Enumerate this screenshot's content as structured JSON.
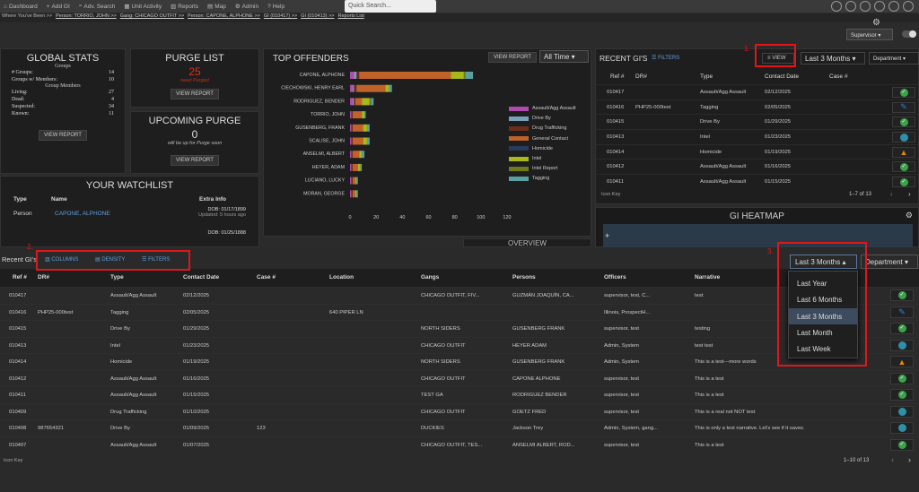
{
  "topbar": {
    "items": [
      "Dashboard",
      "Add GI",
      "Adv. Search",
      "Unit Activity",
      "Reports",
      "Map",
      "Admin",
      "Help"
    ],
    "search_placeholder": "Quick Search...",
    "role": "Supervisor"
  },
  "breadcrumb": {
    "label": "Where You've Been >>",
    "items": [
      "Person: TORRIO, JOHN >>",
      "Gang: CHICAGO OUTFIT >>",
      "Person: CAPONE, ALPHONE >>",
      "GI (010417) >>",
      "GI (010413) >>",
      "Reports List"
    ]
  },
  "global_stats": {
    "title": "GLOBAL STATS",
    "groups_head": "Groups",
    "members_head": "Group Members",
    "rows1": [
      [
        "# Groups:",
        "14"
      ],
      [
        "Groups w/ Members:",
        "10"
      ]
    ],
    "rows2": [
      [
        "Living:",
        "27"
      ],
      [
        "Dead:",
        "4"
      ],
      [
        "Suspected:",
        "34"
      ],
      [
        "Known:",
        "11"
      ]
    ],
    "view": "VIEW REPORT"
  },
  "purge": {
    "title": "PURGE LIST",
    "count": "25",
    "sub": "need Purged",
    "view": "VIEW REPORT"
  },
  "upcoming": {
    "title": "UPCOMING PURGE",
    "count": "0",
    "sub": "will be up for Purge soon",
    "view": "VIEW REPORT"
  },
  "watchlist": {
    "title": "YOUR WATCHLIST",
    "headers": [
      "Type",
      "Name",
      "Extra Info"
    ],
    "rows": [
      {
        "type": "Person",
        "name": "CAPONE, ALPHONE",
        "info1": "DOB: 01/17/1899",
        "info2": "Updated: 5 hours ago"
      },
      {
        "type": "",
        "name": "",
        "info1": "DOB: 01/25/1888",
        "info2": ""
      }
    ]
  },
  "offenders": {
    "title": "TOP OFFENDERS",
    "view": "VIEW REPORT",
    "period": "All Time",
    "names": [
      "CAPONE, ALPHONE",
      "CIECHOWSKI, HENRY EARL",
      "RODRIGUEZ, BENDER",
      "TORRIO, JOHN",
      "GUSENBERG, FRANK",
      "SCALISE, JOHN",
      "ANSELMI, ALBERT",
      "HEYER, ADAM",
      "LUCIANO, LUCKY",
      "MORAN, GEORGE"
    ],
    "ticks": [
      "0",
      "20",
      "40",
      "60",
      "80",
      "100",
      "120"
    ],
    "legend": [
      "Assault/Agg Assault",
      "Drive By",
      "Drug Trafficking",
      "General Contact",
      "Homicide",
      "Intel",
      "Intel Report",
      "Tagging"
    ]
  },
  "chart_data": {
    "type": "bar",
    "orientation": "horizontal",
    "stacked": true,
    "xlim": [
      0,
      120
    ],
    "categories": [
      "CAPONE, ALPHONE",
      "CIECHOWSKI, HENRY EARL",
      "RODRIGUEZ, BENDER",
      "TORRIO, JOHN",
      "GUSENBERG, FRANK",
      "SCALISE, JOHN",
      "ANSELMI, ALBERT",
      "HEYER, ADAM",
      "LUCIANO, LUCKY",
      "MORAN, GEORGE"
    ],
    "series": [
      {
        "name": "Assault/Agg Assault",
        "color": "#b04ab0",
        "values": [
          3,
          2,
          2,
          1,
          1,
          1,
          1,
          1,
          1,
          1
        ]
      },
      {
        "name": "Drive By",
        "color": "#7aa0b8",
        "values": [
          2,
          1,
          1,
          0,
          0,
          0,
          0,
          0,
          0,
          0
        ]
      },
      {
        "name": "Drug Trafficking",
        "color": "#6a2e1e",
        "values": [
          2,
          2,
          1,
          1,
          1,
          1,
          1,
          1,
          1,
          1
        ]
      },
      {
        "name": "General Contact",
        "color": "#c0622a",
        "values": [
          70,
          22,
          5,
          7,
          8,
          8,
          5,
          4,
          2,
          2
        ]
      },
      {
        "name": "Homicide",
        "color": "#2a3a5a",
        "values": [
          0,
          0,
          0,
          0,
          0,
          0,
          0,
          0,
          0,
          0
        ]
      },
      {
        "name": "Intel",
        "color": "#a8b81a",
        "values": [
          10,
          3,
          6,
          2,
          3,
          3,
          2,
          2,
          1,
          1
        ]
      },
      {
        "name": "Intel Report",
        "color": "#6f7a1a",
        "values": [
          1,
          0,
          1,
          0,
          0,
          0,
          0,
          0,
          0,
          0
        ]
      },
      {
        "name": "Tagging",
        "color": "#5aa0a0",
        "values": [
          6,
          2,
          2,
          1,
          2,
          2,
          2,
          1,
          1,
          1
        ]
      }
    ],
    "legend_position": "right"
  },
  "recent_small": {
    "title": "RECENT GI'S",
    "filters": "FILTERS",
    "view": "VIEW",
    "period": "Last 3 Months",
    "dept": "Department",
    "headers": [
      "Ref #",
      "DR#",
      "Type",
      "Contact Date",
      "Case #"
    ],
    "rows": [
      {
        "ref": "010417",
        "dr": "",
        "type": "Assault/Agg Assault",
        "date": "02/12/2025",
        "icon": "check"
      },
      {
        "ref": "010416",
        "dr": "PHP25-000test",
        "type": "Tagging",
        "date": "02/05/2025",
        "icon": "pencil"
      },
      {
        "ref": "010415",
        "dr": "",
        "type": "Drive By",
        "date": "01/29/2025",
        "icon": "check"
      },
      {
        "ref": "010413",
        "dr": "",
        "type": "Intel",
        "date": "01/23/2025",
        "icon": "globe"
      },
      {
        "ref": "010414",
        "dr": "",
        "type": "Homicide",
        "date": "01/19/2025",
        "icon": "warn"
      },
      {
        "ref": "010412",
        "dr": "",
        "type": "Assault/Agg Assault",
        "date": "01/16/2025",
        "icon": "check"
      },
      {
        "ref": "010411",
        "dr": "",
        "type": "Assault/Agg Assault",
        "date": "01/15/2025",
        "icon": "check"
      }
    ],
    "iconkey": "Icon Key",
    "pager": "1–7 of 13"
  },
  "heatmap": {
    "title": "GI HEATMAP"
  },
  "overview": {
    "title": "OVERVIEW"
  },
  "annotations": {
    "one": "1.",
    "two": "2.",
    "three": "3."
  },
  "main": {
    "title": "Recent GI's",
    "columns": "COLUMNS",
    "density": "DENSITY",
    "filters": "FILTERS",
    "period": "Last 3 Months",
    "dept": "Department",
    "headers": [
      "Ref #",
      "DR#",
      "Type",
      "Contact Date",
      "Case #",
      "Location",
      "Gangs",
      "Persons",
      "Officers",
      "Narrative"
    ],
    "rows": [
      {
        "ref": "010417",
        "dr": "",
        "type": "Assault/Agg Assault",
        "date": "02/12/2025",
        "case": "",
        "loc": "",
        "gangs": "CHICAGO OUTFIT, FIV...",
        "persons": "GUZMÁN JOAQUÍN, CA...",
        "officers": "supervisor, test, C...",
        "narr": "test",
        "icon": "check"
      },
      {
        "ref": "010416",
        "dr": "PHP25-000test",
        "type": "Tagging",
        "date": "02/05/2025",
        "case": "",
        "loc": "640 PIPER LN",
        "gangs": "",
        "persons": "",
        "officers": "Illinois, ProspectH...",
        "narr": "",
        "icon": "pencil"
      },
      {
        "ref": "010415",
        "dr": "",
        "type": "Drive By",
        "date": "01/29/2025",
        "case": "",
        "loc": "",
        "gangs": "NORTH SIDERS",
        "persons": "GUSENBERG FRANK",
        "officers": "supervisor, test",
        "narr": "testing",
        "icon": "check"
      },
      {
        "ref": "010413",
        "dr": "",
        "type": "Intel",
        "date": "01/23/2025",
        "case": "",
        "loc": "",
        "gangs": "CHICAGO OUTFIT",
        "persons": "HEYER ADAM",
        "officers": "Admin, System",
        "narr": "test test",
        "icon": "globe"
      },
      {
        "ref": "010414",
        "dr": "",
        "type": "Homicide",
        "date": "01/19/2025",
        "case": "",
        "loc": "",
        "gangs": "NORTH SIDERS",
        "persons": "GUSENBERG FRANK",
        "officers": "Admin, System",
        "narr": "This is a test---more words",
        "icon": "warn"
      },
      {
        "ref": "010412",
        "dr": "",
        "type": "Assault/Agg Assault",
        "date": "01/16/2025",
        "case": "",
        "loc": "",
        "gangs": "CHICAGO OUTFIT",
        "persons": "CAPONE ALPHONE",
        "officers": "supervisor, test",
        "narr": "This is a test",
        "icon": "check"
      },
      {
        "ref": "010411",
        "dr": "",
        "type": "Assault/Agg Assault",
        "date": "01/15/2025",
        "case": "",
        "loc": "",
        "gangs": "TEST GA",
        "persons": "RODRIGUEZ BENDER",
        "officers": "supervisor, test",
        "narr": "This is a test",
        "icon": "check"
      },
      {
        "ref": "010409",
        "dr": "",
        "type": "Drug Trafficking",
        "date": "01/10/2025",
        "case": "",
        "loc": "",
        "gangs": "CHICAGO OUTFIT",
        "persons": "GOETZ FRED",
        "officers": "supervisor, test",
        "narr": "This is a real not NOT test",
        "icon": "globe"
      },
      {
        "ref": "010408",
        "dr": "987654321",
        "type": "Drive By",
        "date": "01/09/2025",
        "case": "123",
        "loc": "",
        "gangs": "DUCKIES",
        "persons": "Jackson Trey",
        "officers": "Admin, System, gang...",
        "narr": "This is only a test narrative. Let's see if it saves.",
        "icon": "globe"
      },
      {
        "ref": "010407",
        "dr": "",
        "type": "Assault/Agg Assault",
        "date": "01/07/2025",
        "case": "",
        "loc": "",
        "gangs": "CHICAGO OUTFIT, TES...",
        "persons": "ANSELMI ALBERT, ROD...",
        "officers": "supervisor, test",
        "narr": "This is a test",
        "icon": "check"
      }
    ],
    "iconkey": "Icon Key",
    "pager": "1–10 of 13"
  },
  "dropdown": {
    "items": [
      "Last Year",
      "Last 6 Months",
      "Last 3 Months",
      "Last Month",
      "Last Week"
    ],
    "selected": 2
  },
  "colors": {
    "check": "#3aa34a",
    "pencil": "#2f7fe0",
    "globe": "#2f8fa8",
    "warn": "#e58a00",
    "accent": "#5ea0e0",
    "red": "#e0161b"
  }
}
